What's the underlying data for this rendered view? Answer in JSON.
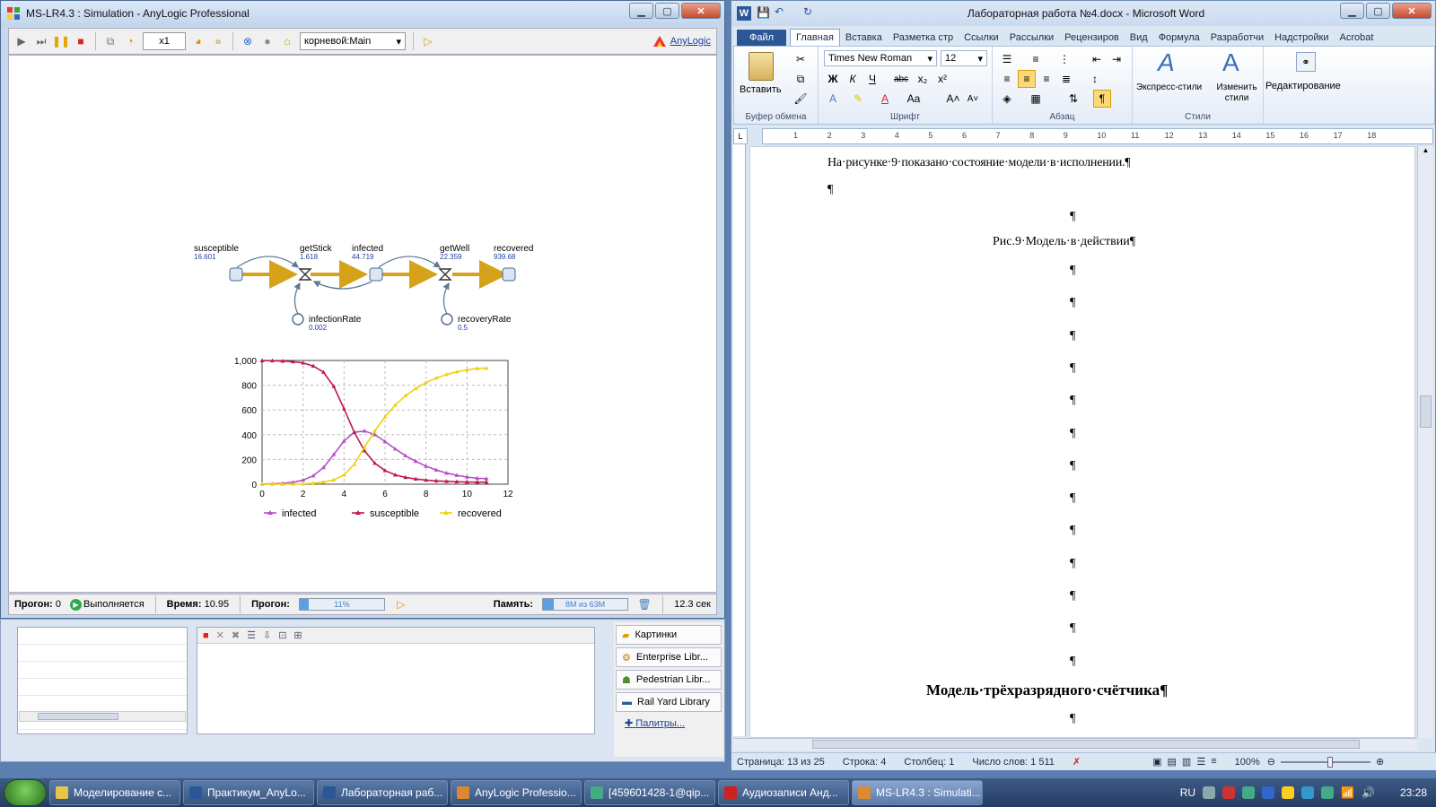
{
  "anylogic": {
    "title": "MS-LR4.3 : Simulation - AnyLogic Professional",
    "speed": "x1",
    "experiment": "корневой:Main",
    "brand_link": "AnyLogic",
    "model": {
      "stocks": [
        {
          "name": "susceptible",
          "value": "16.601"
        },
        {
          "name": "infected",
          "value": "44.719"
        },
        {
          "name": "recovered",
          "value": "939.68"
        }
      ],
      "flows": [
        {
          "name": "getStick",
          "value": "1.618"
        },
        {
          "name": "getWell",
          "value": "22.359"
        }
      ],
      "params": [
        {
          "name": "infectionRate",
          "value": "0.002"
        },
        {
          "name": "recoveryRate",
          "value": "0.5"
        }
      ]
    },
    "status": {
      "run_label": "Прогон:",
      "run_value": "0",
      "state": "Выполняется",
      "time_label": "Время:",
      "time_value": "10.95",
      "progress_label": "Прогон:",
      "progress_text": "11%",
      "progress": 0.11,
      "memory_label": "Память:",
      "memory_text": "8M из 63M",
      "memory": 0.13,
      "elapsed": "12.3 сек"
    },
    "palette": [
      {
        "label": "Картинки"
      },
      {
        "label": "Enterprise Libr..."
      },
      {
        "label": "Pedestrian Libr..."
      },
      {
        "label": "Rail Yard Library"
      }
    ],
    "palette_link": "Палитры..."
  },
  "chart_data": {
    "type": "line",
    "title": "",
    "xlabel": "",
    "ylabel": "",
    "xlim": [
      0,
      12
    ],
    "ylim": [
      0,
      1000
    ],
    "x_ticks": [
      0,
      2,
      4,
      6,
      8,
      10,
      12
    ],
    "y_ticks": [
      0,
      200,
      400,
      600,
      800,
      1000
    ],
    "y_tick_labels": [
      "0",
      "200",
      "400",
      "600",
      "800",
      "1,000"
    ],
    "grid": true,
    "legend": "bottom",
    "x": [
      0,
      0.5,
      1,
      1.5,
      2,
      2.5,
      3,
      3.5,
      4,
      4.5,
      5,
      5.5,
      6,
      6.5,
      7,
      7.5,
      8,
      8.5,
      9,
      9.5,
      10,
      10.5,
      10.95
    ],
    "series": [
      {
        "name": "infected",
        "color": "#b44fc4",
        "values": [
          1,
          3,
          7,
          15,
          33,
          68,
          135,
          240,
          350,
          420,
          430,
          400,
          345,
          285,
          230,
          185,
          145,
          115,
          90,
          72,
          58,
          48,
          45
        ]
      },
      {
        "name": "susceptible",
        "color": "#c0184a",
        "values": [
          999,
          998,
          995,
          990,
          980,
          955,
          905,
          790,
          610,
          420,
          270,
          170,
          110,
          75,
          55,
          42,
          33,
          27,
          23,
          20,
          18,
          17,
          17
        ]
      },
      {
        "name": "recovered",
        "color": "#f0d010",
        "values": [
          0,
          0,
          0,
          1,
          3,
          8,
          18,
          35,
          75,
          160,
          300,
          430,
          545,
          640,
          715,
          773,
          822,
          858,
          887,
          908,
          924,
          935,
          938
        ]
      }
    ]
  },
  "word": {
    "title": "Лабораторная работа №4.docx - Microsoft Word",
    "tabs": [
      "Файл",
      "Главная",
      "Вставка",
      "Разметка стр",
      "Ссылки",
      "Рассылки",
      "Рецензиров",
      "Вид",
      "Формула",
      "Разработчи",
      "Надстройки",
      "Acrobat"
    ],
    "font_name": "Times New Roman",
    "font_size": "12",
    "paste_label": "Вставить",
    "express_styles": "Экспресс-стили",
    "change_styles": "Изменить стили",
    "editing": "Редактирование",
    "groups": {
      "clipboard": "Буфер обмена",
      "font": "Шрифт",
      "paragraph": "Абзац",
      "styles": "Стили"
    },
    "ruler_numbers": [
      "1",
      "2",
      "3",
      "4",
      "5",
      "6",
      "7",
      "8",
      "9",
      "10",
      "11",
      "12",
      "13",
      "14",
      "15",
      "16",
      "17",
      "18"
    ],
    "doc": {
      "para1": "На·рисунке·9·показано·состояние·модели·в·исполнении.¶",
      "pilcrow": "¶",
      "caption": "Рис.9·Модель·в·действии¶",
      "heading": "Модель·трёхразрядного·счётчика¶"
    },
    "status": {
      "page": "Страница: 13 из 25",
      "line": "Строка: 4",
      "column": "Столбец: 1",
      "words": "Число слов: 1 511",
      "zoom": "100%"
    }
  },
  "taskbar": {
    "items": [
      {
        "label": "Моделирование с..."
      },
      {
        "label": "Практикум_AnyLo..."
      },
      {
        "label": "Лабораторная раб..."
      },
      {
        "label": "AnyLogic Professio..."
      },
      {
        "label": "[459601428-1@qip..."
      },
      {
        "label": "Аудиозаписи Анд..."
      },
      {
        "label": "MS-LR4.3 : Simulati..."
      }
    ],
    "lang": "RU",
    "clock": "23:28"
  }
}
